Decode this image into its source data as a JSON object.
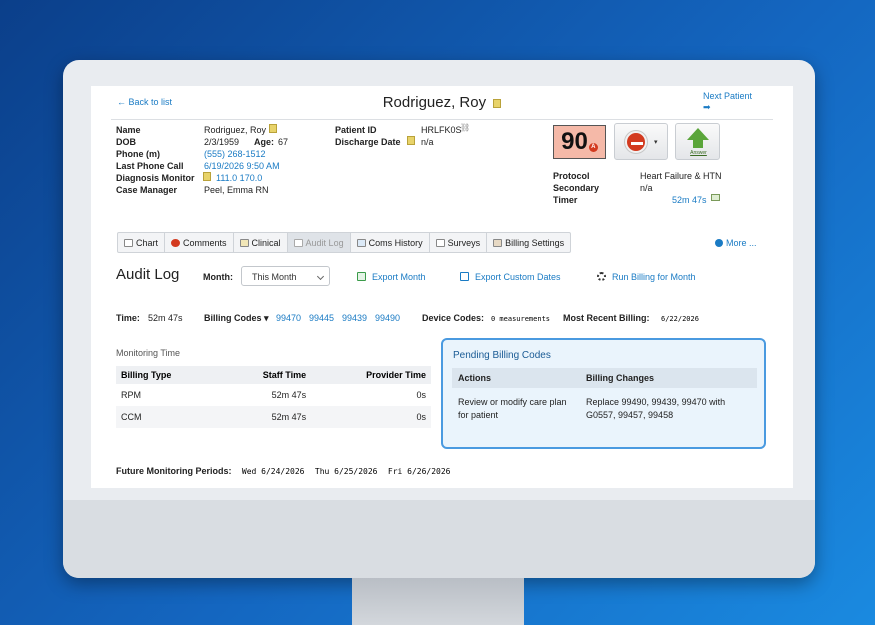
{
  "header": {
    "back_link": "← Back to list",
    "patient_name": "Rodriguez, Roy",
    "next_patient": "Next Patient"
  },
  "patient": {
    "name_label": "Name",
    "name": "Rodriguez, Roy",
    "dob_label": "DOB",
    "dob": "2/3/1959",
    "age_label": "Age:",
    "age": "67",
    "phone_label": "Phone (m)",
    "phone": "(555) 268-1512",
    "last_call_label": "Last Phone Call",
    "last_call": "6/19/2026 9:50 AM",
    "diag_label": "Diagnosis Monitor",
    "diag_values": "111.0  170.0",
    "case_mgr_label": "Case Manager",
    "case_mgr": "Peel, Emma RN",
    "patient_id_label": "Patient ID",
    "patient_id": "HRLFK0S",
    "discharge_label": "Discharge Date",
    "discharge": "n/a"
  },
  "status": {
    "score": "90",
    "answer_label": "Answer",
    "protocol_label": "Protocol",
    "protocol": "Heart Failure & HTN",
    "secondary_label": "Secondary",
    "secondary": "n/a",
    "timer_label": "Timer",
    "timer": "52m 47s"
  },
  "tabs": [
    {
      "label": "Chart"
    },
    {
      "label": "Comments"
    },
    {
      "label": "Clinical"
    },
    {
      "label": "Audit Log"
    },
    {
      "label": "Coms History"
    },
    {
      "label": "Surveys"
    },
    {
      "label": "Billing Settings"
    }
  ],
  "more_label": "More ...",
  "audit": {
    "title": "Audit Log",
    "month_label": "Month:",
    "month_value": "This Month",
    "export_month": "Export Month",
    "export_custom": "Export Custom Dates",
    "run_billing": "Run Billing for Month"
  },
  "summary": {
    "time_label": "Time:",
    "time": "52m 47s",
    "billing_codes_label": "Billing Codes ▾",
    "codes": [
      "99470",
      "99445",
      "99439",
      "99490"
    ],
    "device_codes_label": "Device Codes:",
    "device_codes": "0 measurements",
    "recent_billing_label": "Most Recent Billing:",
    "recent_billing": "6/22/2026"
  },
  "monitoring": {
    "title": "Monitoring Time",
    "headers": [
      "Billing Type",
      "Staff Time",
      "Provider Time"
    ],
    "rows": [
      [
        "RPM",
        "52m 47s",
        "0s"
      ],
      [
        "CCM",
        "52m 47s",
        "0s"
      ]
    ]
  },
  "pending": {
    "title": "Pending Billing Codes",
    "headers": [
      "Actions",
      "Billing Changes"
    ],
    "action": "Review or modify care plan for patient",
    "change": "Replace 99490, 99439, 99470 with G0557, 99457, 99458"
  },
  "future": {
    "label": "Future Monitoring Periods:",
    "dates": [
      "Wed 6/24/2026",
      "Thu 6/25/2026",
      "Fri 6/26/2026"
    ]
  },
  "colors": {
    "link": "#1a7bc4",
    "score_bg": "#f5b9a8",
    "alert_red": "#d33a1f",
    "answer_green": "#5aa53a",
    "pending_border": "#4a9ae0"
  }
}
